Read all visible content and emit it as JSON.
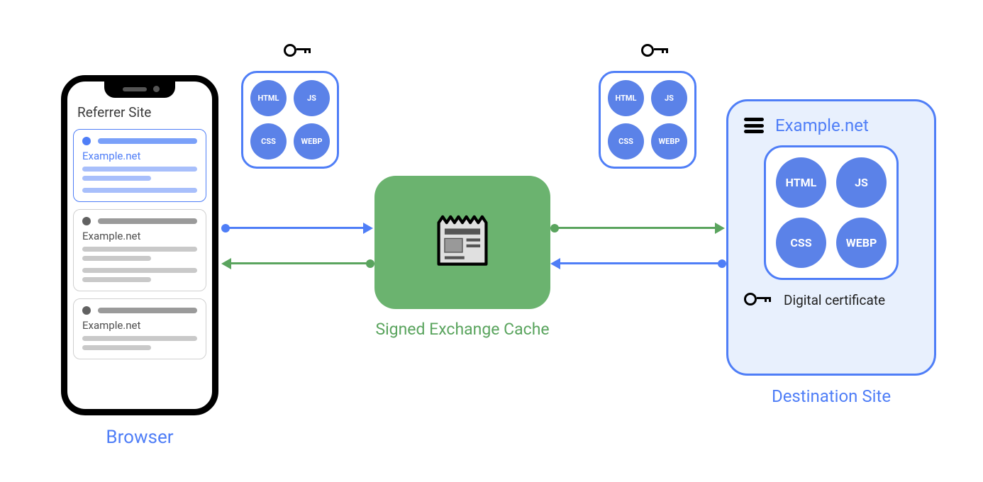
{
  "browser": {
    "label": "Browser",
    "referrer_title": "Referrer Site",
    "cards": [
      {
        "site": "Example.net",
        "selected": true
      },
      {
        "site": "Example.net",
        "selected": false
      },
      {
        "site": "Example.net",
        "selected": false
      }
    ]
  },
  "bundle_a": {
    "assets": [
      "HTML",
      "JS",
      "CSS",
      "WEBP"
    ]
  },
  "bundle_b": {
    "assets": [
      "HTML",
      "JS",
      "CSS",
      "WEBP"
    ]
  },
  "cache": {
    "label": "Signed Exchange Cache"
  },
  "destination": {
    "title": "Example.net",
    "assets": [
      "HTML",
      "JS",
      "CSS",
      "WEBP"
    ],
    "certificate_label": "Digital certificate",
    "caption": "Destination Site"
  },
  "colors": {
    "blue": "#4f7ef7",
    "green_fill": "#6bb36f",
    "green_text": "#5aa45e",
    "light_blue": "#e8f0fd"
  }
}
